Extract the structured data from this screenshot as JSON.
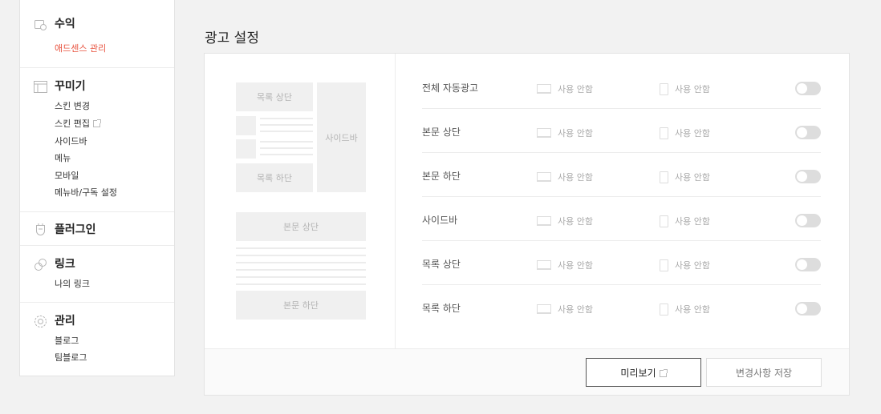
{
  "sidebar": {
    "revenue": {
      "title": "수익",
      "items": [
        "애드센스 관리"
      ]
    },
    "decorate": {
      "title": "꾸미기",
      "items": [
        "스킨 변경",
        "스킨 편집",
        "사이드바",
        "메뉴",
        "모바일",
        "메뉴바/구독 설정"
      ]
    },
    "plugin": {
      "title": "플러그인"
    },
    "link": {
      "title": "링크",
      "items": [
        "나의 링크"
      ]
    },
    "manage": {
      "title": "관리",
      "items": [
        "블로그",
        "팀블로그"
      ]
    }
  },
  "page_title": "광고 설정",
  "preview": {
    "list_top": "목록 상단",
    "list_bottom": "목록 하단",
    "sidebar": "사이드바",
    "body_top": "본문 상단",
    "body_bottom": "본문 하단"
  },
  "ad_rows": [
    {
      "label": "전체 자동광고",
      "pc": "사용 안함",
      "mobile": "사용 안함",
      "enabled": false
    },
    {
      "label": "본문 상단",
      "pc": "사용 안함",
      "mobile": "사용 안함",
      "enabled": false
    },
    {
      "label": "본문 하단",
      "pc": "사용 안함",
      "mobile": "사용 안함",
      "enabled": false
    },
    {
      "label": "사이드바",
      "pc": "사용 안함",
      "mobile": "사용 안함",
      "enabled": false
    },
    {
      "label": "목록 상단",
      "pc": "사용 안함",
      "mobile": "사용 안함",
      "enabled": false
    },
    {
      "label": "목록 하단",
      "pc": "사용 안함",
      "mobile": "사용 안함",
      "enabled": false
    }
  ],
  "buttons": {
    "preview": "미리보기",
    "save": "변경사항 저장"
  },
  "colors": {
    "active_link": "#e8533f",
    "toggle_off": "#dddddd"
  }
}
